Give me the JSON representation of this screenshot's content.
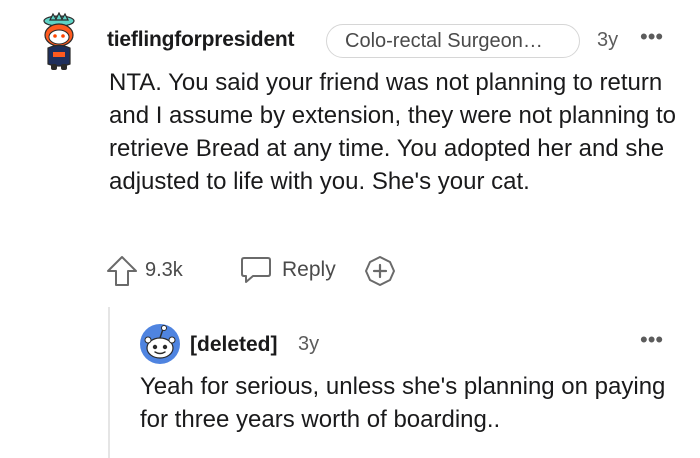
{
  "comment": {
    "username": "tieflingforpresident",
    "flair": "Colo-rectal Surgeon…",
    "time": "3y",
    "more": "•••",
    "body": "NTA. You said your friend was not planning to return and I assume by extension, they were not planning to retrieve Bread at any time. You adopted her and she adjusted to life with you. She's your cat.",
    "actions": {
      "score": "9.3k",
      "reply_label": "Reply"
    }
  },
  "reply": {
    "username": "[deleted]",
    "time": "3y",
    "more": "•••",
    "body": "Yeah for serious, unless she's planning on paying for three years worth of boarding.."
  },
  "icons": {
    "upvote": "upvote-arrow-icon",
    "reply": "speech-bubble-icon",
    "award": "award-plus-icon",
    "more": "ellipsis-icon"
  },
  "colors": {
    "text": "#1a1a1b",
    "muted": "#5c5c5c",
    "flair_border": "#d6d6d6",
    "thread_line": "#e5e5e5",
    "avatar1_accent": "#ff4500",
    "avatar2_accent": "#4f84e0"
  }
}
